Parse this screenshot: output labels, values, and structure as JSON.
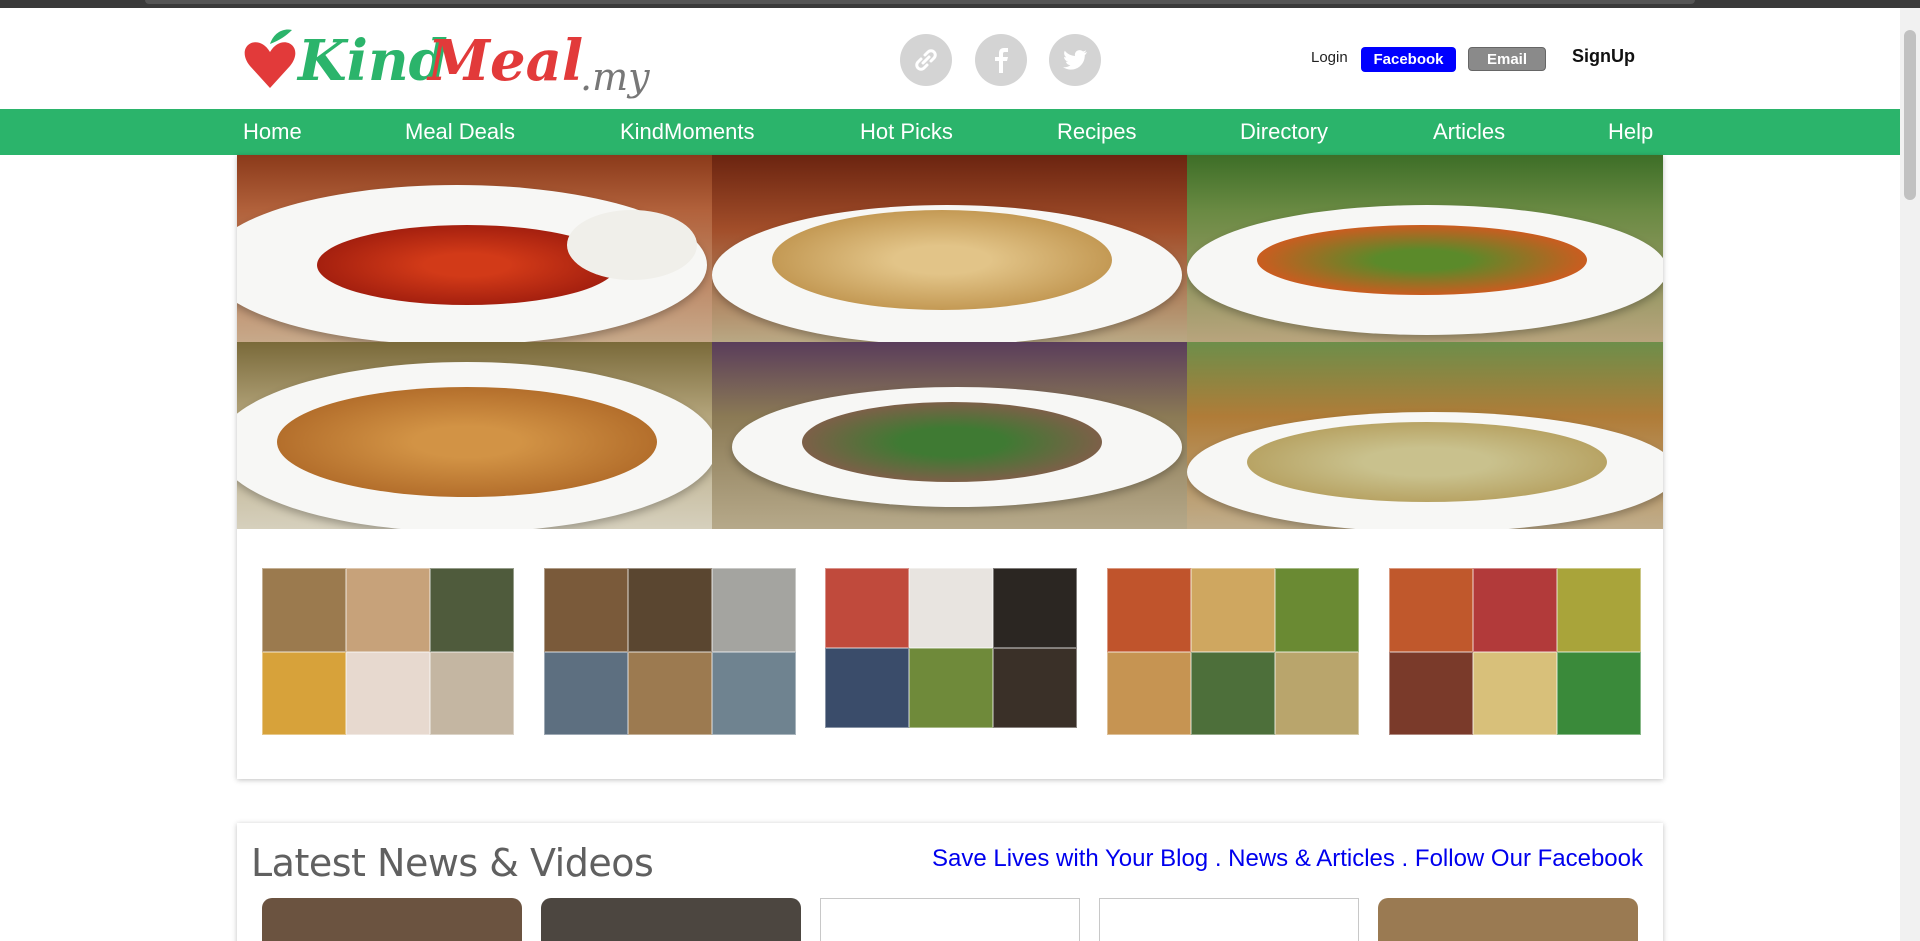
{
  "header": {
    "logo_text": "KindMeal",
    "logo_suffix": ".my",
    "social_icons": [
      "link-icon",
      "facebook-icon",
      "twitter-icon"
    ],
    "login_label": "Login",
    "facebook_label": "Facebook",
    "email_label": "Email",
    "signup_label": "SignUp"
  },
  "nav": {
    "items": [
      "Home",
      "Meal Deals",
      "KindMoments",
      "Hot Picks",
      "Recipes",
      "Directory",
      "Articles",
      "Help"
    ]
  },
  "news": {
    "title": "Latest News & Videos",
    "link_blog": "Save Lives with Your Blog",
    "sep1": " . ",
    "link_articles": "News & Articles",
    "sep2": " . ",
    "link_facebook": "Follow Our Facebook"
  },
  "colors": {
    "nav_green": "#2bb46b",
    "facebook_blue": "#0000ff",
    "email_gray": "#8a8a8a",
    "link_blue": "#0000ee"
  }
}
